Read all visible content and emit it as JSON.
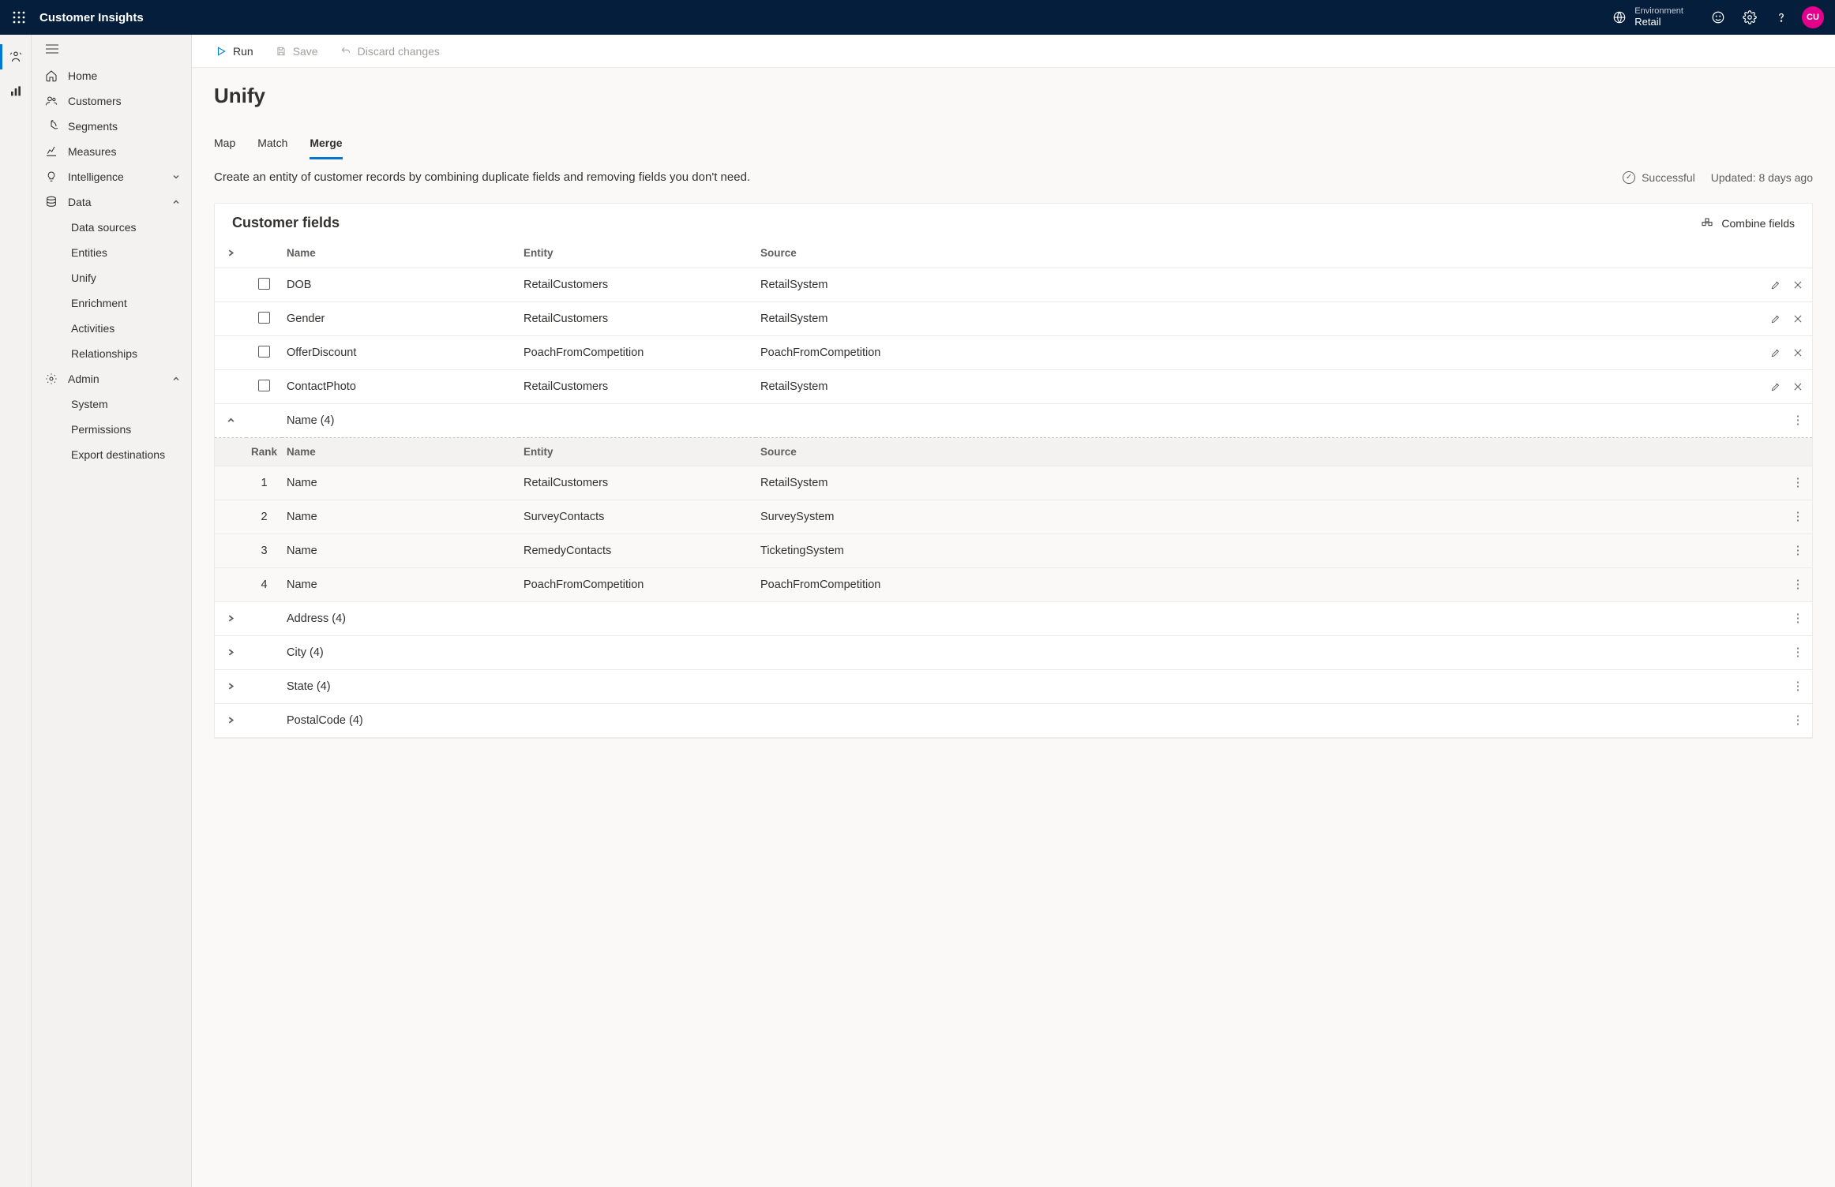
{
  "topbar": {
    "product": "Customer Insights",
    "env_label": "Environment",
    "env_name": "Retail",
    "avatar": "CU"
  },
  "sidebar": {
    "home": "Home",
    "customers": "Customers",
    "segments": "Segments",
    "measures": "Measures",
    "intelligence": "Intelligence",
    "data": "Data",
    "data_items": {
      "data_sources": "Data sources",
      "entities": "Entities",
      "unify": "Unify",
      "enrichment": "Enrichment",
      "activities": "Activities",
      "relationships": "Relationships"
    },
    "admin": "Admin",
    "admin_items": {
      "system": "System",
      "permissions": "Permissions",
      "export": "Export destinations"
    }
  },
  "cmdbar": {
    "run": "Run",
    "save": "Save",
    "discard": "Discard changes"
  },
  "page": {
    "title": "Unify",
    "tabs": {
      "map": "Map",
      "match": "Match",
      "merge": "Merge"
    },
    "description": "Create an entity of customer records by combining duplicate fields and removing fields you don't need.",
    "status_label": "Successful",
    "updated_label": "Updated: 8 days ago"
  },
  "card": {
    "title": "Customer fields",
    "combine": "Combine fields",
    "headers": {
      "name": "Name",
      "entity": "Entity",
      "source": "Source",
      "rank": "Rank"
    },
    "rows": [
      {
        "name": "DOB",
        "entity": "RetailCustomers",
        "source": "RetailSystem"
      },
      {
        "name": "Gender",
        "entity": "RetailCustomers",
        "source": "RetailSystem"
      },
      {
        "name": "OfferDiscount",
        "entity": "PoachFromCompetition",
        "source": "PoachFromCompetition"
      },
      {
        "name": "ContactPhoto",
        "entity": "RetailCustomers",
        "source": "RetailSystem"
      }
    ],
    "expanded_group": {
      "label": "Name (4)",
      "items": [
        {
          "rank": "1",
          "name": "Name",
          "entity": "RetailCustomers",
          "source": "RetailSystem"
        },
        {
          "rank": "2",
          "name": "Name",
          "entity": "SurveyContacts",
          "source": "SurveySystem"
        },
        {
          "rank": "3",
          "name": "Name",
          "entity": "RemedyContacts",
          "source": "TicketingSystem"
        },
        {
          "rank": "4",
          "name": "Name",
          "entity": "PoachFromCompetition",
          "source": "PoachFromCompetition"
        }
      ]
    },
    "collapsed_groups": [
      {
        "label": "Address (4)"
      },
      {
        "label": "City (4)"
      },
      {
        "label": "State (4)"
      },
      {
        "label": "PostalCode (4)"
      }
    ]
  }
}
